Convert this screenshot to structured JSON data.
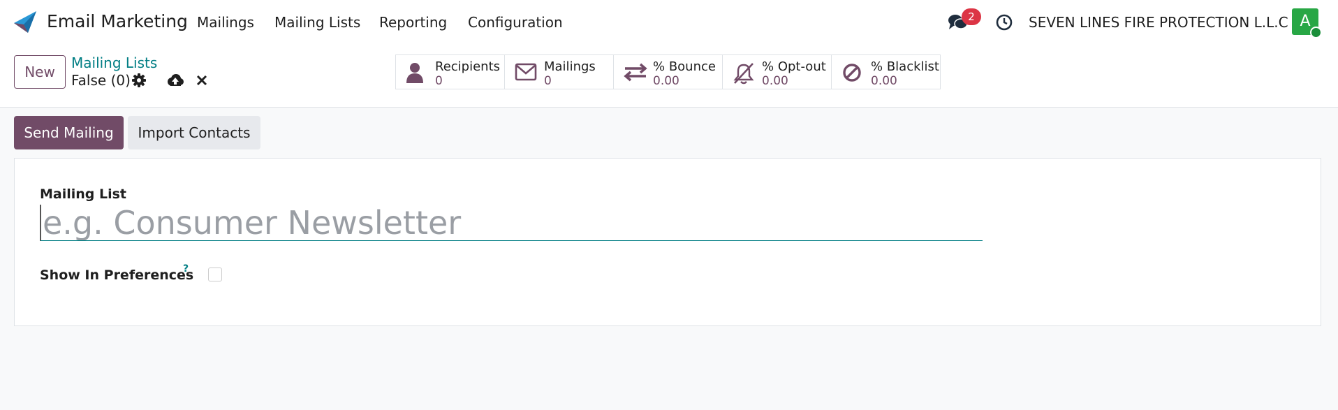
{
  "navbar": {
    "app_name": "Email Marketing",
    "menu": [
      "Mailings",
      "Mailing Lists",
      "Reporting",
      "Configuration"
    ],
    "chat_count": "2",
    "company": "SEVEN LINES FIRE PROTECTION L.L.C",
    "avatar_initial": "A",
    "avatar_color": "#28a745",
    "icons": [
      "paper-plane-icon",
      "chat-bubbles-icon",
      "clock-icon"
    ]
  },
  "control_panel": {
    "new_label": "New",
    "breadcrumb": "Mailing Lists",
    "record_name": "False (0)",
    "icons": [
      "gear-icon",
      "cloud-upload-icon",
      "close-icon"
    ],
    "stats": [
      {
        "label": "Recipients",
        "value": "0",
        "icon": "user-icon"
      },
      {
        "label": "Mailings",
        "value": "0",
        "icon": "envelope-icon"
      },
      {
        "label": "% Bounce",
        "value": "0.00",
        "icon": "exchange-icon"
      },
      {
        "label": "% Opt-out",
        "value": "0.00",
        "icon": "bell-slash-icon"
      },
      {
        "label": "% Blacklist",
        "value": "0.00",
        "icon": "ban-icon"
      }
    ]
  },
  "actions": {
    "send_label": "Send Mailing",
    "import_label": "Import Contacts"
  },
  "form": {
    "mailing_list_label": "Mailing List",
    "name_value": "",
    "name_placeholder": "e.g. Consumer Newsletter",
    "show_pref_label": "Show In Preferences",
    "help_mark": "?",
    "show_pref_checked": false
  },
  "colors": {
    "primary": "#714b67",
    "link": "#017e84",
    "danger": "#dc3545"
  }
}
